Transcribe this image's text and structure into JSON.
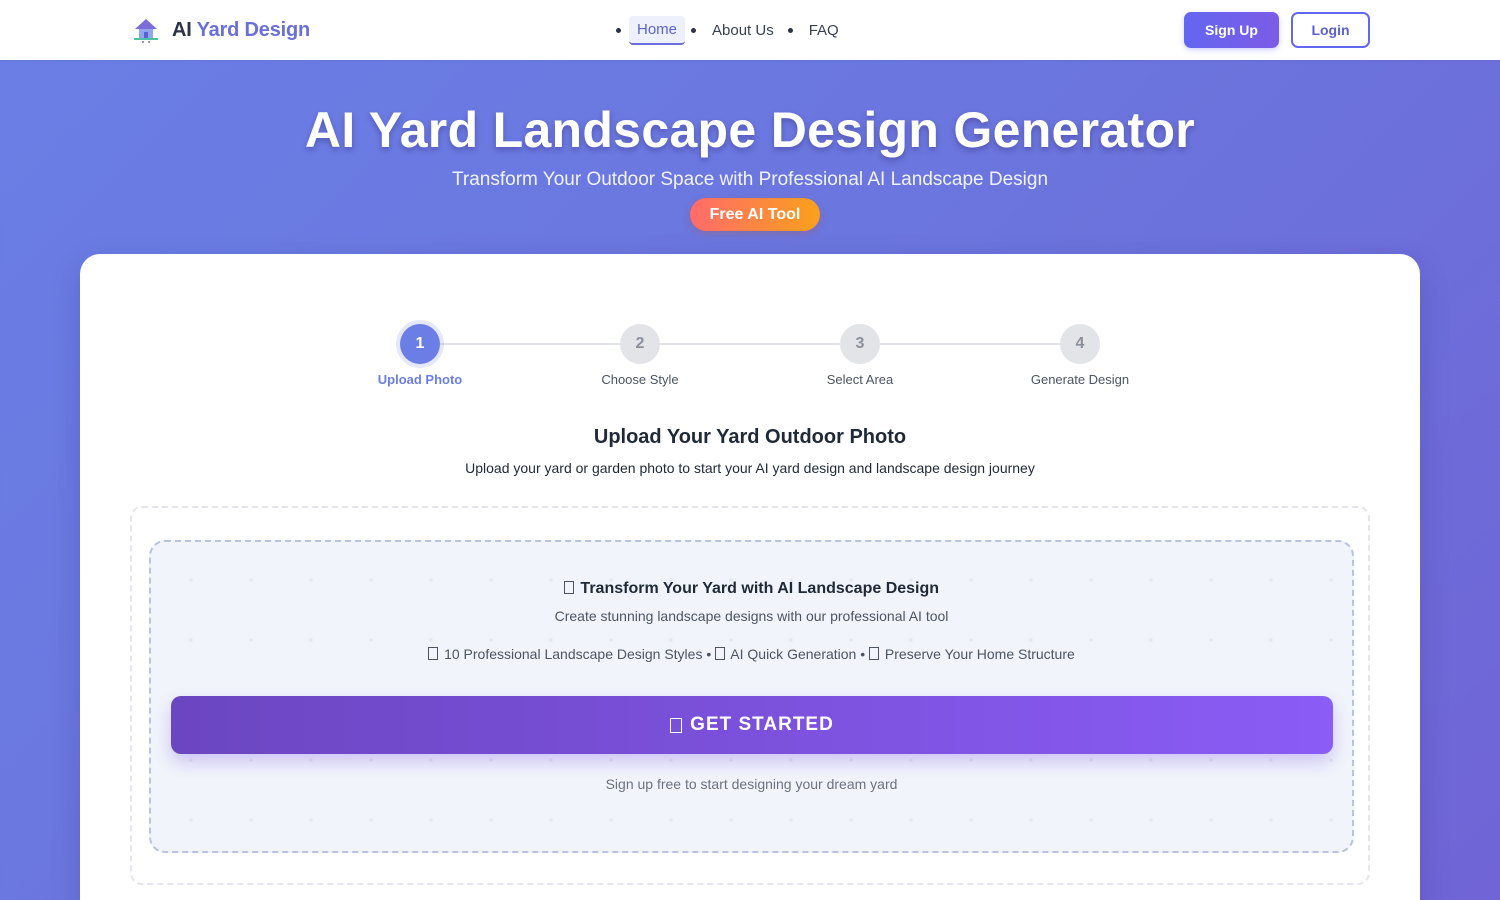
{
  "header": {
    "brand": {
      "prefix": "AI",
      "name": "Yard Design",
      "logo_icon": "house-icon"
    },
    "nav": [
      {
        "label": "Home",
        "active": true
      },
      {
        "label": "About Us",
        "active": false
      },
      {
        "label": "FAQ",
        "active": false
      }
    ],
    "signup_label": "Sign Up",
    "login_label": "Login"
  },
  "hero": {
    "title": "AI Yard Landscape Design Generator",
    "subtitle": "Transform Your Outdoor Space with Professional AI Landscape Design",
    "badge": "Free AI Tool"
  },
  "stepper": {
    "current": 1,
    "steps": [
      {
        "number": "1",
        "label": "Upload Photo"
      },
      {
        "number": "2",
        "label": "Choose Style"
      },
      {
        "number": "3",
        "label": "Select Area"
      },
      {
        "number": "4",
        "label": "Generate Design"
      }
    ]
  },
  "upload": {
    "title": "Upload Your Yard Outdoor Photo",
    "description": "Upload your yard or garden photo to start your AI yard design and landscape design journey",
    "promo": {
      "title": "Transform Your Yard with AI Landscape Design",
      "subtitle": "Create stunning landscape designs with our professional AI tool",
      "features": [
        "10 Professional Landscape Design Styles",
        "AI Quick Generation",
        "Preserve Your Home Structure"
      ],
      "feature_separator": "•",
      "cta_label": "GET STARTED",
      "note": "Sign up free to start designing your dream yard"
    }
  },
  "colors": {
    "accent": "#6366f1",
    "brand_text": "#6a6fdc",
    "hero_bg_start": "#6a7fe6",
    "hero_bg_end": "#7064d6",
    "badge_start": "#ff6b6b",
    "badge_end": "#f9a01b",
    "cta_start": "#6b46c1",
    "cta_end": "#8b5cf6",
    "step_active": "#6b7ee6"
  }
}
